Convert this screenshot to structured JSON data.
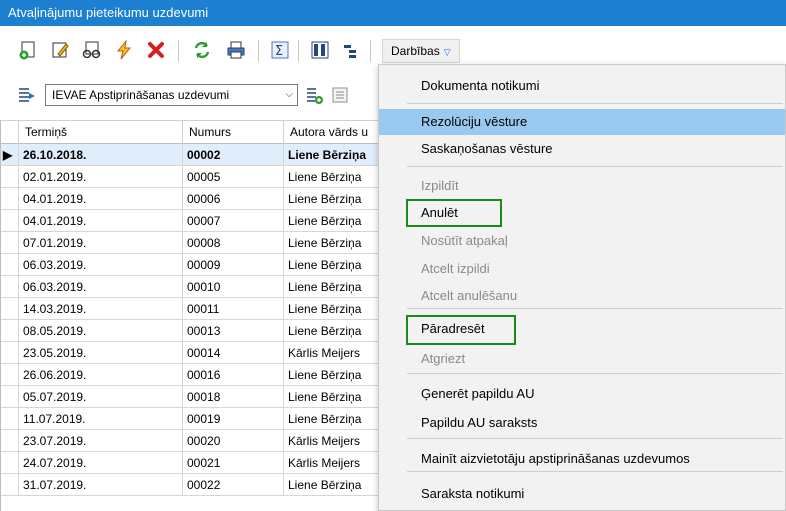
{
  "window": {
    "title": "Atvaļinājumu pieteikumu uzdevumi"
  },
  "toolbar": {
    "icons": [
      "new-doc-icon",
      "edit-icon",
      "view-icon",
      "lightning-icon",
      "delete-icon",
      "refresh-icon",
      "print-icon",
      "sum-icon",
      "columns-icon",
      "tree-icon"
    ],
    "actions_label": "Darbības",
    "colors": {
      "title_bg": "#1c7fd1",
      "highlight_border": "#1a8a1a",
      "menu_hover": "#99c9ef"
    }
  },
  "filter": {
    "selected": "IEVAE Apstiprināšanas uzdevumi"
  },
  "grid": {
    "columns": [
      "Termiņš",
      "Numurs",
      "Autora vārds u"
    ],
    "rows": [
      {
        "date": "26.10.2018.",
        "num": "00002",
        "author": "Liene Bērziņa",
        "current": true
      },
      {
        "date": "02.01.2019.",
        "num": "00005",
        "author": "Liene Bērziņa"
      },
      {
        "date": "04.01.2019.",
        "num": "00006",
        "author": "Liene Bērziņa"
      },
      {
        "date": "04.01.2019.",
        "num": "00007",
        "author": "Liene Bērziņa"
      },
      {
        "date": "07.01.2019.",
        "num": "00008",
        "author": "Liene Bērziņa"
      },
      {
        "date": "06.03.2019.",
        "num": "00009",
        "author": "Liene Bērziņa"
      },
      {
        "date": "06.03.2019.",
        "num": "00010",
        "author": "Liene Bērziņa"
      },
      {
        "date": "14.03.2019.",
        "num": "00011",
        "author": "Liene Bērziņa"
      },
      {
        "date": "08.05.2019.",
        "num": "00013",
        "author": "Liene Bērziņa"
      },
      {
        "date": "23.05.2019.",
        "num": "00014",
        "author": "Kārlis Meijers"
      },
      {
        "date": "26.06.2019.",
        "num": "00016",
        "author": "Liene Bērziņa"
      },
      {
        "date": "05.07.2019.",
        "num": "00018",
        "author": "Liene Bērziņa"
      },
      {
        "date": "11.07.2019.",
        "num": "00019",
        "author": "Liene Bērziņa"
      },
      {
        "date": "23.07.2019.",
        "num": "00020",
        "author": "Kārlis Meijers"
      },
      {
        "date": "24.07.2019.",
        "num": "00021",
        "author": "Kārlis Meijers"
      },
      {
        "date": "31.07.2019.",
        "num": "00022",
        "author": "Liene Bērziņa"
      }
    ]
  },
  "menu": {
    "items": [
      {
        "label": "Dokumenta notikumi",
        "disabled": false
      },
      {
        "label": "Rezolūciju vēsture",
        "disabled": false,
        "hover": true
      },
      {
        "label": "Saskaņošanas vēsture",
        "disabled": false
      },
      {
        "label": "Izpildīt",
        "disabled": true
      },
      {
        "label": "Anulēt",
        "disabled": false,
        "highlighted": true
      },
      {
        "label": "Nosūtīt atpakaļ",
        "disabled": true
      },
      {
        "label": "Atcelt izpildi",
        "disabled": true
      },
      {
        "label": "Atcelt anulēšanu",
        "disabled": true
      },
      {
        "label": "Pāradresēt",
        "disabled": false,
        "highlighted": true
      },
      {
        "label": "Atgriezt",
        "disabled": true
      },
      {
        "label": "Ģenerēt papildu AU",
        "disabled": false
      },
      {
        "label": "Papildu AU saraksts",
        "disabled": false
      },
      {
        "label": "Mainīt aizvietotāju apstiprināšanas uzdevumos",
        "disabled": false
      },
      {
        "label": "Saraksta notikumi",
        "disabled": false
      }
    ]
  }
}
